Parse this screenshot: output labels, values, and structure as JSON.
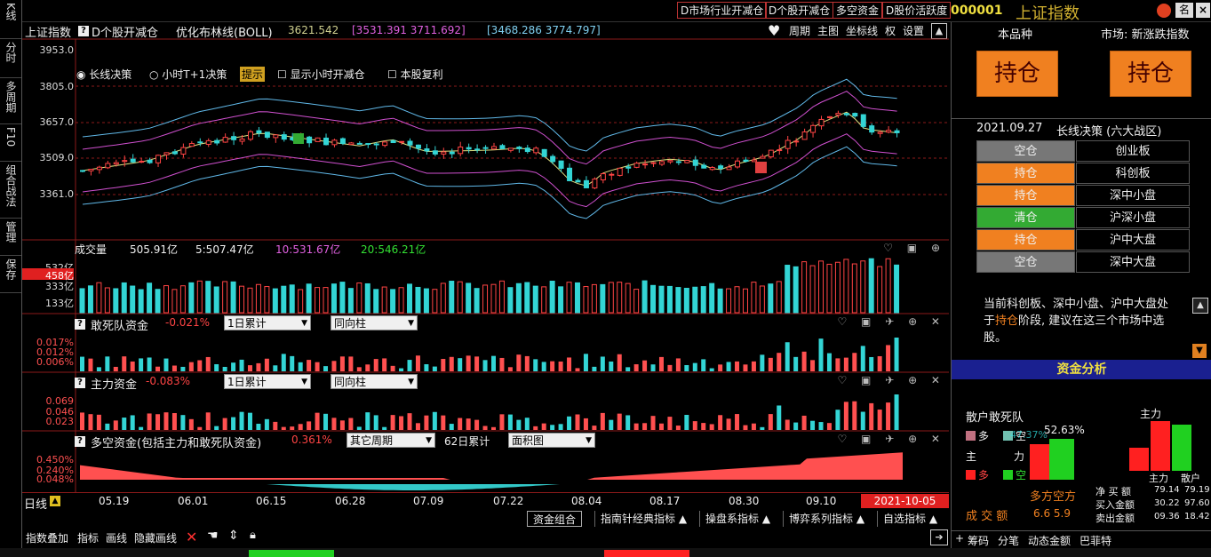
{
  "top": {
    "buttons": [
      "D市场行业开减仓",
      "D个股开减仓",
      "多空资金",
      "D股价活跃度"
    ],
    "code": "000001",
    "name": "上证指数",
    "window_buttons": [
      "名",
      "",
      "×"
    ]
  },
  "left_tabs": [
    "K线",
    "分时",
    "多周期",
    "F10",
    "组合战法",
    "管理",
    "保存"
  ],
  "main": {
    "title": "上证指数",
    "indicator": "D个股开减仓",
    "boll_label": "优化布林线(BOLL)",
    "boll_mid": "3621.542",
    "boll_set1": "[3531.391  3711.692]",
    "boll_set2": "[3468.286  3774.797]",
    "toolbar": [
      "周期",
      "主图",
      "坐标线",
      "权",
      "设置"
    ],
    "options": {
      "radio1": "长线决策",
      "radio2": "小时T+1决策",
      "hint": "提示",
      "check1": "显示小时开减仓",
      "check2": "本股复利"
    },
    "y_ticks": [
      "3953.0",
      "3805.0",
      "3657.0",
      "3509.0",
      "3361.0"
    ]
  },
  "volume": {
    "label": "成交量",
    "value": "505.91亿",
    "ma5": "5:507.47亿",
    "ma10": "10:531.67亿",
    "ma20": "20:546.21亿",
    "y_ticks": [
      "532亿",
      "458亿",
      "333亿",
      "133亿"
    ]
  },
  "panel1": {
    "title": "敢死队资金",
    "value": "-0.021%",
    "dd1": "1日累计",
    "dd2": "同向柱",
    "y_ticks": [
      "0.017%",
      "0.012%",
      "0.006%"
    ]
  },
  "panel2": {
    "title": "主力资金",
    "value": "-0.083%",
    "dd1": "1日累计",
    "dd2": "同向柱",
    "y_ticks": [
      "0.069",
      "0.046",
      "0.023"
    ]
  },
  "panel3": {
    "title": "多空资金(包括主力和敢死队资金)",
    "value": "0.361%",
    "dd1": "其它周期",
    "dd_text": "62日累计",
    "dd2": "面积图",
    "y_ticks": [
      "0.450%",
      "0.240%",
      "0.048%"
    ]
  },
  "xaxis": {
    "period": "日线",
    "dates": [
      "05.19",
      "06.01",
      "06.15",
      "06.28",
      "07.09",
      "07.22",
      "08.04",
      "08.17",
      "08.30",
      "09.10"
    ],
    "current": "2021-10-05"
  },
  "indicator_bar": [
    "资金组合",
    "指南针经典指标 ▲",
    "操盘系指标 ▲",
    "博弈系列指标 ▲",
    "自选指标 ▲"
  ],
  "toolbar": [
    "指数叠加",
    "指标",
    "画线",
    "隐藏画线"
  ],
  "right": {
    "label_self": "本品种",
    "label_market": "市场: 新涨跌指数",
    "btn1": "持仓",
    "btn2": "持仓",
    "date": "2021.09.27",
    "strategy": "长线决策 (六大战区)",
    "grid": [
      {
        "state": "空仓",
        "color": "#777777",
        "board": "创业板"
      },
      {
        "state": "持仓",
        "color": "#f08020",
        "board": "科创板"
      },
      {
        "state": "持仓",
        "color": "#f08020",
        "board": "深中小盘"
      },
      {
        "state": "清仓",
        "color": "#33aa33",
        "board": "沪深小盘"
      },
      {
        "state": "持仓",
        "color": "#f08020",
        "board": "沪中大盘"
      },
      {
        "state": "空仓",
        "color": "#777777",
        "board": "深中大盘"
      }
    ],
    "advice_pre": "当前科创板、深中小盘、沪中大盘处于",
    "advice_hl": "持仓",
    "advice_post": "阶段, 建议在这三个市场中选股。",
    "fund_title": "资金分析",
    "retail": "散户敢死队",
    "main_label": "主力",
    "duo": "多",
    "kong": "空",
    "zhu": "主",
    "li": "力",
    "pct1": "52.63%",
    "pct2": "47.37%",
    "duokong": "多方空方",
    "net_buy": "净 买 额",
    "buy_amt": "买入金额",
    "sell_amt": "卖出金额",
    "vol_label": "成 交 额",
    "vol_vals": "6.6  5.9",
    "main_sub": "主力",
    "retail_sub": "散户",
    "n1": "79.14",
    "n2": "79.19",
    "n3": "30.22",
    "n4": "97.60",
    "n5": "09.36",
    "n6": "18.42",
    "tabs": [
      "筹码",
      "分笔",
      "动态金额",
      "巴菲特"
    ]
  },
  "colors": {
    "up": "#ff4444",
    "down": "#33d5d5",
    "frame": "#8b1a1a",
    "orange": "#f08020"
  }
}
